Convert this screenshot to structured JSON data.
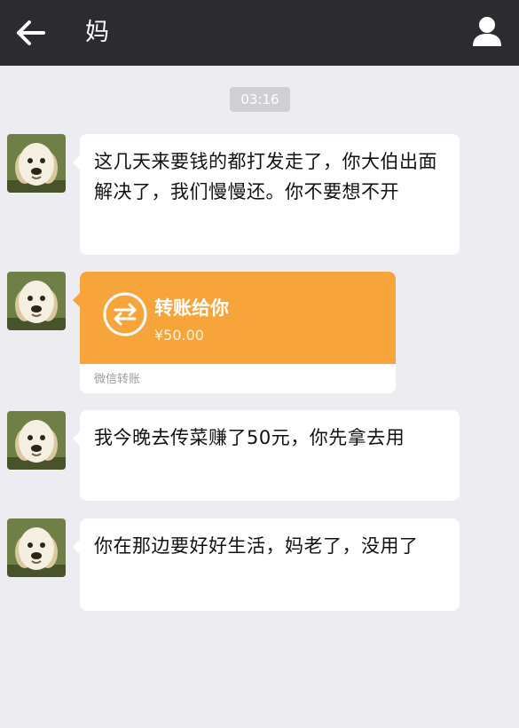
{
  "header": {
    "title": "妈",
    "back_icon": "arrow-left-icon",
    "profile_icon": "person-icon",
    "bg_color": "#2c2c30"
  },
  "chat": {
    "timestamp": "03:16",
    "messages": [
      {
        "type": "text",
        "text": "这几天来要钱的都打发走了，你大伯出面解决了，我们慢慢还。你不要想不开"
      },
      {
        "type": "transfer",
        "title": "转账给你",
        "amount": "¥50.00",
        "footer": "微信转账",
        "accent_color": "#f7a43a"
      },
      {
        "type": "text",
        "text": "我今晚去传菜赚了50元，你先拿去用"
      },
      {
        "type": "text",
        "text": "你在那边要好好生活，妈老了，没用了"
      }
    ]
  }
}
